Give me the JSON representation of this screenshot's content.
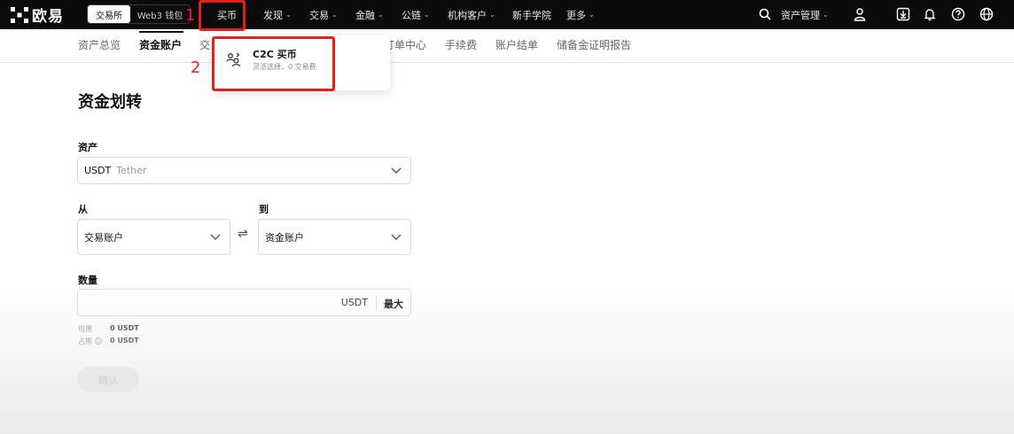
{
  "brand": {
    "name": "欧易"
  },
  "mode_switch": {
    "exchange": "交易所",
    "web3": "Web3 钱包"
  },
  "nav": {
    "items": [
      {
        "label": "买币",
        "chev": ""
      },
      {
        "label": "发现",
        "chev": "⌄"
      },
      {
        "label": "交易",
        "chev": "⌄"
      },
      {
        "label": "金融",
        "chev": "⌄"
      },
      {
        "label": "公链",
        "chev": "⌄"
      },
      {
        "label": "机构客户",
        "chev": "⌄"
      },
      {
        "label": "新手学院",
        "chev": ""
      },
      {
        "label": "更多",
        "chev": "⌄"
      }
    ],
    "asset_management": "资产管理",
    "asset_chev": "⌄",
    "icons": [
      "search-icon",
      "user-icon",
      "download-icon",
      "bell-icon",
      "help-icon",
      "globe-icon"
    ]
  },
  "subtabs": {
    "items": [
      "资产总览",
      "资金账户",
      "交",
      "订单中心",
      "手续费",
      "账户结单",
      "储备金证明报告"
    ]
  },
  "dropdown": {
    "title": "C2C 买币",
    "subtitle": "灵活选择，0 交易费"
  },
  "annotations": {
    "first": "1",
    "second": "2"
  },
  "transfer": {
    "title": "资金划转",
    "asset_label": "资产",
    "asset_symbol": "USDT",
    "asset_name": "Tether",
    "from_label": "从",
    "from_value": "交易账户",
    "to_label": "到",
    "to_value": "资金账户",
    "swap_symbol": "⇌",
    "amount_label": "数量",
    "amount_unit": "USDT",
    "max_label": "最大",
    "available_label": "可用",
    "available_value": "0 USDT",
    "occupied_label": "占用",
    "occupied_value": "0 USDT",
    "confirm_label": "确认"
  },
  "colors": {
    "nav_bg": "#0b0b0b",
    "annotation_red": "#e2211b"
  }
}
